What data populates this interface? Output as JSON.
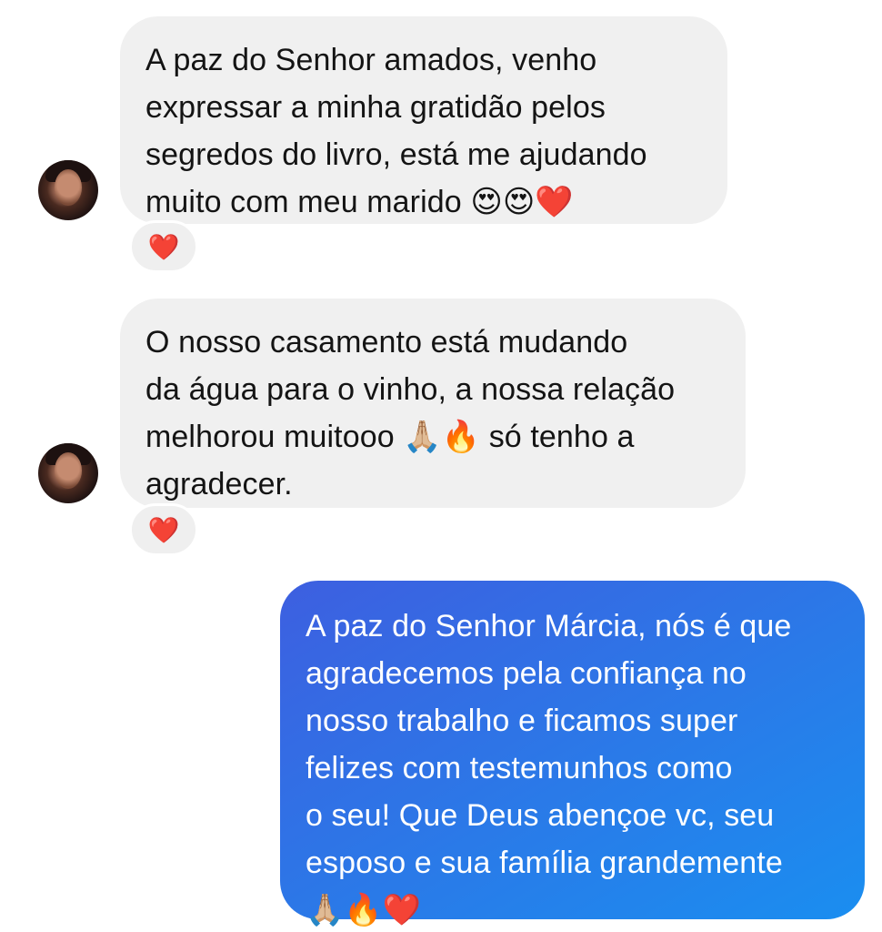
{
  "conversation": {
    "messages": [
      {
        "direction": "incoming",
        "lines": [
          "A paz do Senhor amados, venho",
          "expressar a minha gratidão pelos",
          "segredos do livro, está me ajudando",
          "muito com meu marido 😍😍❤️"
        ],
        "reaction": "❤️"
      },
      {
        "direction": "incoming",
        "lines": [
          "O nosso casamento está mudando",
          "da água para o vinho, a nossa relação",
          "melhorou muitooo 🙏🏼🔥 só tenho a",
          "agradecer."
        ],
        "reaction": "❤️"
      },
      {
        "direction": "outgoing",
        "lines": [
          "A paz do Senhor Márcia, nós é que",
          "agradecemos pela confiança no",
          "nosso trabalho e ficamos super",
          "felizes com testemunhos como",
          "o seu! Que Deus abençoe vc, seu",
          "esposo e sua família grandemente",
          "🙏🏼🔥❤️"
        ]
      }
    ]
  },
  "colors": {
    "incoming_bubble": "#f0f0f0",
    "outgoing_bubble_start": "#3d5fe0",
    "outgoing_bubble_end": "#1a8ef0",
    "reaction_heart": "#e8232f"
  }
}
